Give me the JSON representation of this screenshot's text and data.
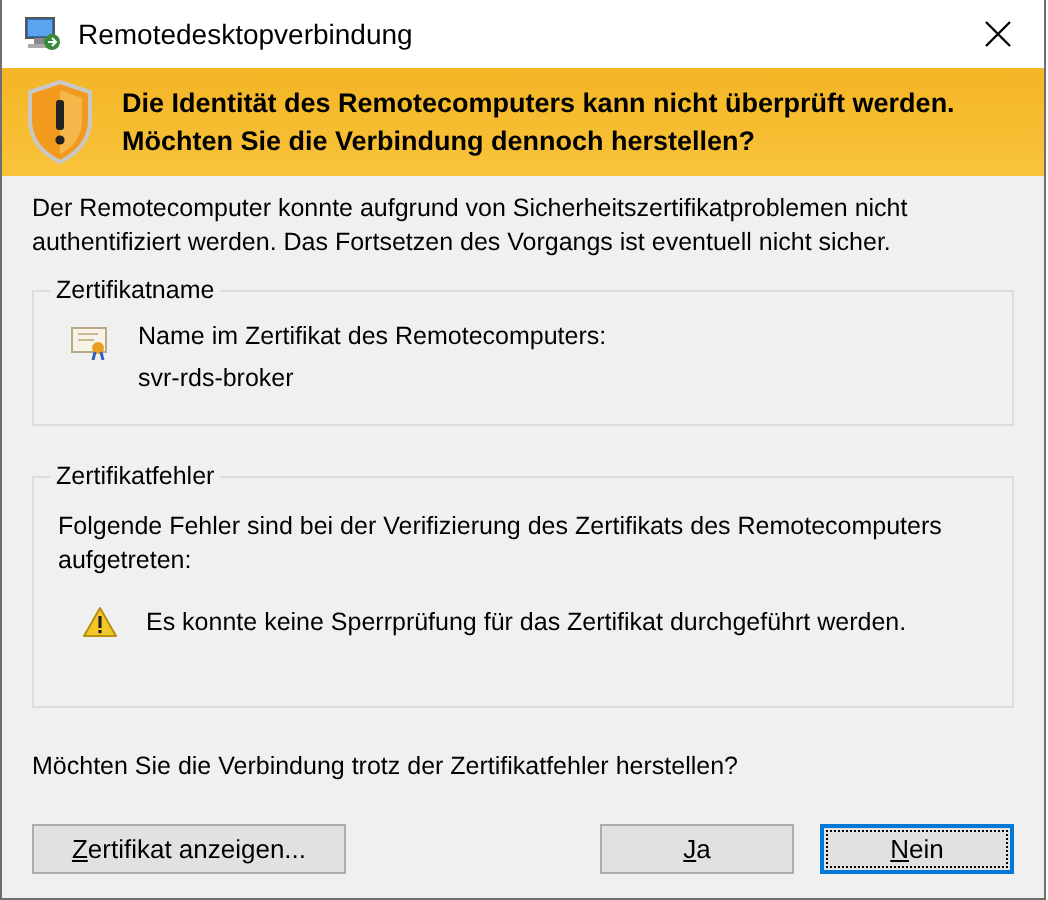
{
  "window": {
    "title": "Remotedesktopverbindung"
  },
  "banner": {
    "text": "Die Identität des Remotecomputers kann nicht überprüft werden. Möchten Sie die Verbindung dennoch herstellen?"
  },
  "intro": "Der Remotecomputer konnte aufgrund von Sicherheitszertifikatproblemen nicht authentifiziert werden. Das Fortsetzen des Vorgangs ist eventuell nicht sicher.",
  "certificate_name": {
    "legend": "Zertifikatname",
    "label": "Name im Zertifikat des Remotecomputers:",
    "value": "svr-rds-broker"
  },
  "certificate_errors": {
    "legend": "Zertifikatfehler",
    "description": "Folgende Fehler sind bei der Verifizierung des Zertifikats des Remotecomputers aufgetreten:",
    "errors": [
      "Es konnte keine Sperrprüfung für das Zertifikat durchgeführt werden."
    ]
  },
  "question": "Möchten Sie die Verbindung trotz der Zertifikatfehler herstellen?",
  "buttons": [
    {
      "label": "Zertifikat anzeigen...",
      "focused": false
    },
    {
      "label": "Ja",
      "focused": false
    },
    {
      "label": "Nein",
      "focused": true
    }
  ]
}
